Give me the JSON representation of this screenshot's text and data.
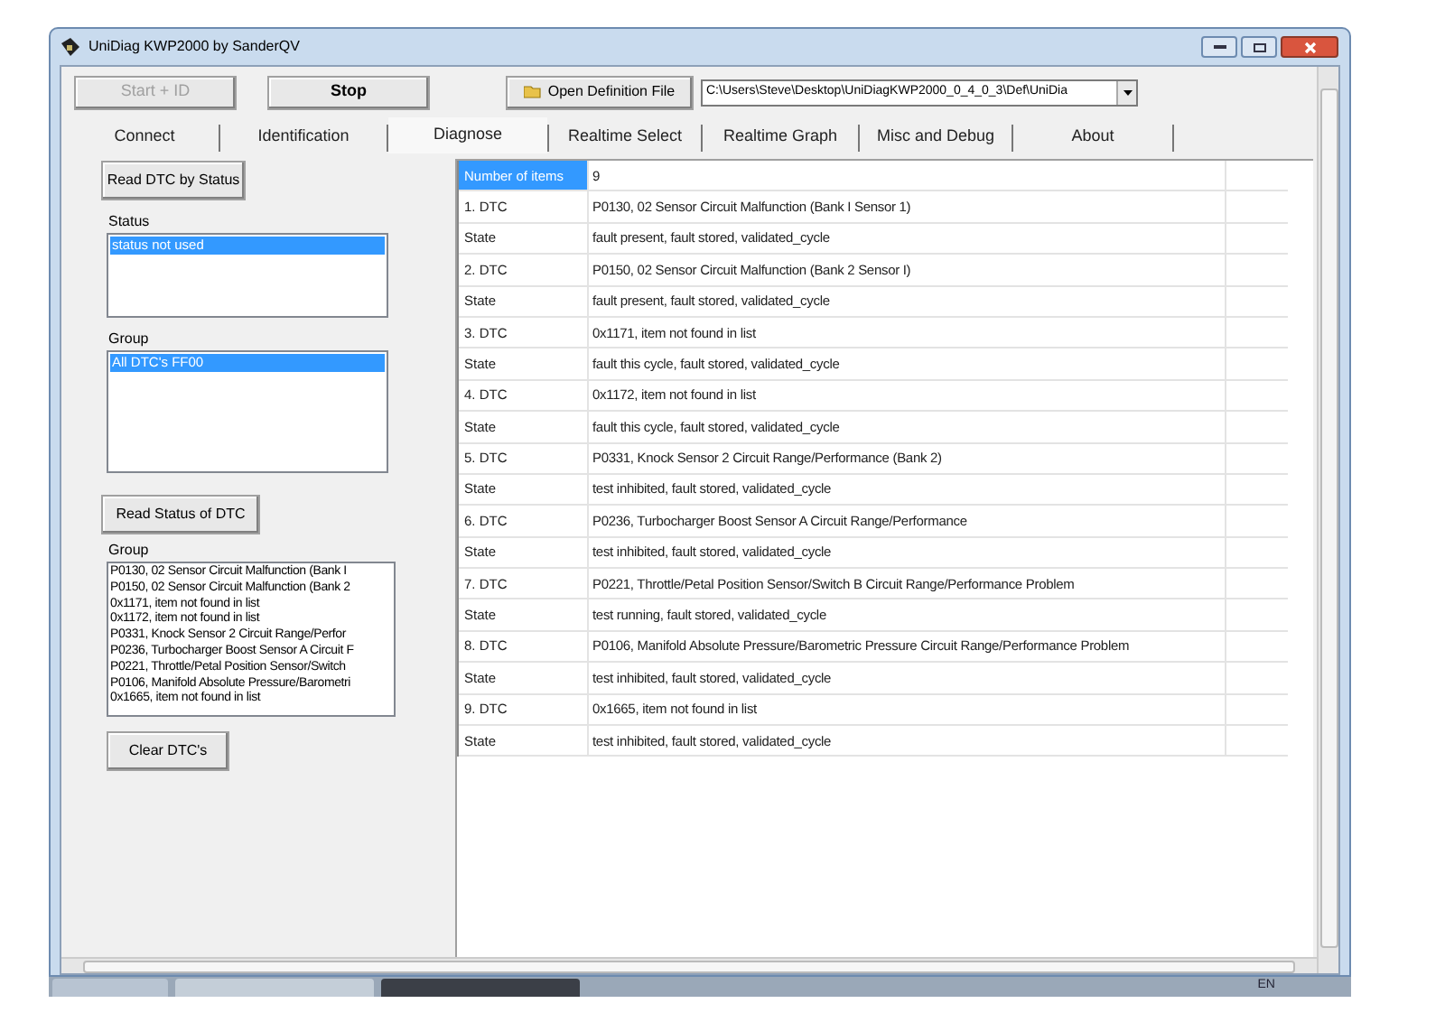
{
  "window": {
    "title": "UniDiag KWP2000 by SanderQV"
  },
  "toolbar": {
    "buttons": [
      {
        "label": "Start + ID",
        "disabled": true
      },
      {
        "label": "Stop",
        "disabled": false
      }
    ],
    "open_button": {
      "label": "Open Definition File"
    },
    "path_combo": {
      "value": "C:\\Users\\Steve\\Desktop\\UniDiagKWP2000_0_4_0_3\\Def\\UniDia"
    }
  },
  "tabs": [
    {
      "label": "Connect",
      "selected": false
    },
    {
      "label": "Identification",
      "selected": false
    },
    {
      "label": "Diagnose",
      "selected": true
    },
    {
      "label": "Realtime Select",
      "selected": false
    },
    {
      "label": "Realtime Graph",
      "selected": false
    },
    {
      "label": "Misc and Debug",
      "selected": false
    },
    {
      "label": "About",
      "selected": false
    }
  ],
  "left_panel": {
    "read_dtc_button": "Read DTC by Status",
    "status": {
      "label": "Status",
      "items": [
        {
          "label": "status not used",
          "selected": true
        }
      ]
    },
    "group": {
      "label": "Group",
      "items": [
        {
          "label": "All DTC's FF00",
          "selected": true
        }
      ]
    },
    "read_status_button": "Read Status of DTC",
    "dtc_group": {
      "label": "Group",
      "items": [
        "P0130, 02 Sensor Circuit Malfunction (Bank I",
        "P0150, 02 Sensor Circuit Malfunction (Bank 2",
        "0x1171, item not found in list",
        "0x1172, item not found in list",
        "P0331, Knock Sensor 2 Circuit Range/Perfor",
        "P0236, Turbocharger Boost Sensor A Circuit F",
        "P0221, Throttle/Petal Position Sensor/Switch",
        "P0106, Manifold Absolute Pressure/Barometri",
        "0x1665, item not found in list"
      ]
    },
    "clear_button": "Clear DTC's"
  },
  "table": {
    "rows": [
      {
        "label": "Number of items",
        "value": "9",
        "selected": true
      },
      {
        "label": "1. DTC",
        "value": "P0130, 02 Sensor Circuit Malfunction (Bank I Sensor 1)",
        "selected": false
      },
      {
        "label": "State",
        "value": "fault present, fault stored, validated_cycle",
        "selected": false
      },
      {
        "label": "2. DTC",
        "value": "P0150, 02 Sensor Circuit Malfunction (Bank 2 Sensor I)",
        "selected": false
      },
      {
        "label": "State",
        "value": "fault present, fault stored, validated_cycle",
        "selected": false
      },
      {
        "label": "3. DTC",
        "value": "0x1171, item not found in list",
        "selected": false
      },
      {
        "label": "State",
        "value": "fault this cycle, fault stored, validated_cycle",
        "selected": false
      },
      {
        "label": "4. DTC",
        "value": "0x1172, item not found in list",
        "selected": false
      },
      {
        "label": "State",
        "value": "fault this cycle, fault stored, validated_cycle",
        "selected": false
      },
      {
        "label": "5. DTC",
        "value": "P0331, Knock Sensor 2 Circuit Range/Performance (Bank 2)",
        "selected": false
      },
      {
        "label": "State",
        "value": "test inhibited, fault stored, validated_cycle",
        "selected": false
      },
      {
        "label": "6. DTC",
        "value": "P0236, Turbocharger Boost Sensor A Circuit Range/Performance",
        "selected": false
      },
      {
        "label": "State",
        "value": "test inhibited, fault stored, validated_cycle",
        "selected": false
      },
      {
        "label": "7. DTC",
        "value": "P0221, Throttle/Petal Position Sensor/Switch B Circuit Range/Performance Problem",
        "selected": false
      },
      {
        "label": "State",
        "value": "test running, fault stored, validated_cycle",
        "selected": false
      },
      {
        "label": "8. DTC",
        "value": "P0106, Manifold Absolute Pressure/Barometric Pressure Circuit Range/Performance Problem",
        "selected": false
      },
      {
        "label": "State",
        "value": "test inhibited, fault stored, validated_cycle",
        "selected": false
      },
      {
        "label": "9. DTC",
        "value": "0x1665, item not found in list",
        "selected": false
      },
      {
        "label": "State",
        "value": "test inhibited, fault stored, validated_cycle",
        "selected": false
      }
    ]
  },
  "taskbar": {
    "language": "EN"
  }
}
